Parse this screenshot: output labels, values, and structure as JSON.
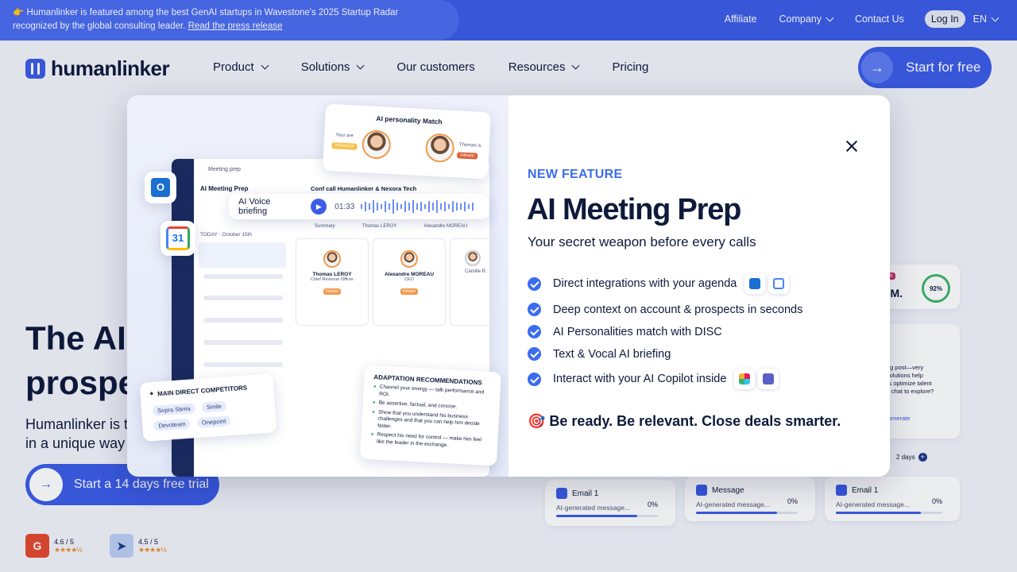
{
  "announcement": {
    "line1": "👉 Humanlinker is featured among the best GenAI startups in Wavestone's 2025 Startup Radar",
    "line2": "recognized by the global consulting leader.",
    "link": "Read the press release"
  },
  "topnav": {
    "affiliate": "Affiliate",
    "company": "Company",
    "contact": "Contact Us",
    "login": "Log In",
    "lang": "EN"
  },
  "brand": {
    "name": "humanlinker",
    "primary_color": "#3b5ce6"
  },
  "nav": {
    "items": [
      "Product",
      "Solutions",
      "Our customers",
      "Resources",
      "Pricing"
    ],
    "cta": "Start for free"
  },
  "hero": {
    "title_line1": "The AI",
    "title_line2": "prospe",
    "sub_line1": "Humanlinker is t",
    "sub_line2": "in a unique way",
    "button": "Start a 14 days free trial",
    "ratings": [
      {
        "score": "4.6 / 5",
        "stars": "★★★★½"
      },
      {
        "score": "4.5 / 5",
        "stars": "★★★★½"
      }
    ]
  },
  "bg_cards": {
    "name": "n M.",
    "tag": "in",
    "score": "92%",
    "post": [
      "og post—very",
      "solutions help",
      "rs optimize talent",
      "k chat to explore?"
    ],
    "generate": "enerate",
    "delay": "2 days",
    "emails": [
      {
        "title": "Email 1",
        "desc": "AI-generated message...",
        "pct": "0%",
        "progress": 0.8
      },
      {
        "title": "Message",
        "desc": "AI-generated message...",
        "pct": "0%",
        "progress": 0.8
      },
      {
        "title": "Email 1",
        "desc": "AI-generated message...",
        "pct": "0%",
        "progress": 0.8
      }
    ]
  },
  "modal": {
    "kicker": "NEW FEATURE",
    "title": "AI Meeting Prep",
    "subtitle": "Your secret weapon before every calls",
    "features": [
      "Direct integrations with your agenda",
      "Deep context on account & prospects in seconds",
      "AI Personalities match with DISC",
      "Text & Vocal AI briefing",
      "Interact with your AI Copilot inside"
    ],
    "tagline": "🎯 Be ready. Be relevant. Close deals smarter.",
    "illustration": {
      "personality_title": "AI personality Match",
      "you_are": "Your are",
      "you_tag": "Influencer",
      "thomas_is": "Thomas is",
      "thomas_tag": "Initiator",
      "meeting_prep": "Meeting prep",
      "ai_meeting_prep": "AI Meeting Prep",
      "meeting_name": "Conf call Humanlinker & Nexora Tech",
      "voice": "AI Voice briefing",
      "time": "01:33",
      "tabs": [
        "Summary",
        "Thomas LEROY",
        "Alexandre MOREAU"
      ],
      "people": [
        {
          "name": "Thomas LEROY",
          "role": "Chief Revenue Officer",
          "tag": "Initiator"
        },
        {
          "name": "Alexandre MOREAU",
          "role": "CEO",
          "tag": "Initiator"
        },
        {
          "name": "Camille R.",
          "role": "",
          "tag": ""
        }
      ],
      "day": "TODAY · October 15th",
      "competitors_title": "MAIN DIRECT COMPETITORS",
      "competitors": [
        "Sopra Steria",
        "Smile",
        "Devoteam",
        "Onepoint"
      ],
      "adapt_title": "ADAPTATION RECOMMENDATIONS",
      "adapt": [
        "Channel your energy — talk performance and ROI.",
        "Be assertive, factual, and concise.",
        "Show that you understand his business challenges and that you can help him decide faster.",
        "Respect his need for control — make him feel like the leader in the exchange."
      ],
      "calendar_day": "31"
    }
  }
}
